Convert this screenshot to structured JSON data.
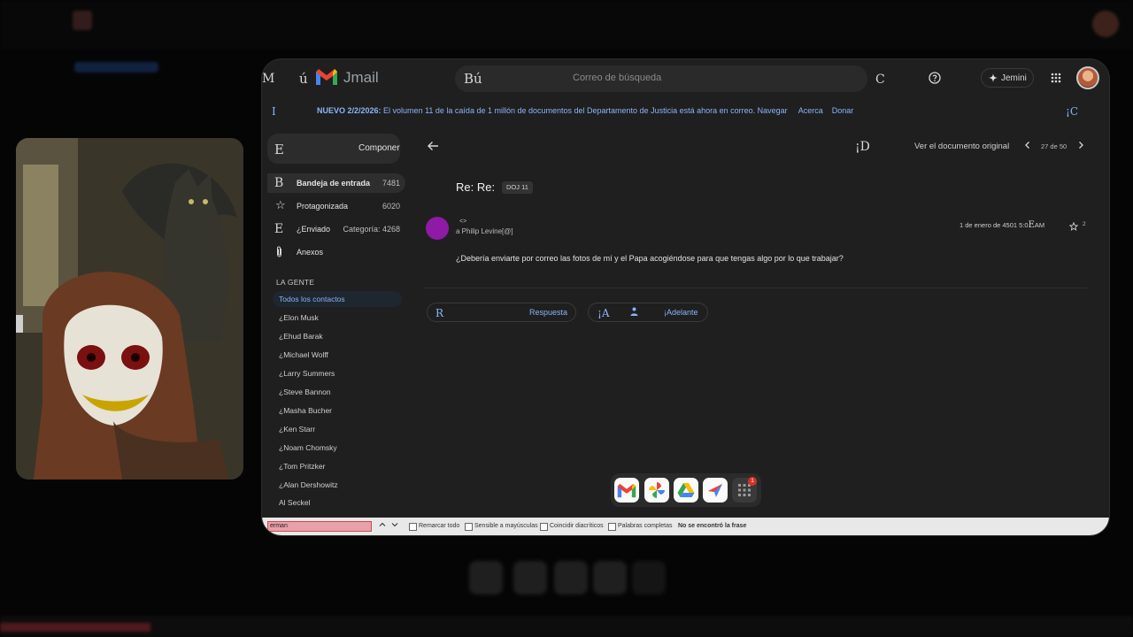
{
  "app": {
    "brand": "Jmail",
    "menu_glyph": "M",
    "left_glyph": "ú"
  },
  "search": {
    "glyph": "Bú",
    "placeholder": "Correo de búsqueda",
    "right_glyph": "C"
  },
  "topbar": {
    "help_icon": "help-circle-icon",
    "assistant_label": "Jemini",
    "apps_icon": "apps-grid-icon"
  },
  "banner": {
    "left_glyph": "I",
    "bold": "NUEVO 2/2/2026:",
    "text": " El volumen 11 de la caída de 1 millón de documentos del Departamento de Justicia está ahora en correo.",
    "nav_link": "Navegar",
    "about_link": "Acerca",
    "donate_link": "Donar",
    "right_glyph": "¡C"
  },
  "sidebar": {
    "compose_glyph": "E",
    "compose_label": "Componer",
    "items": [
      {
        "glyph": "B",
        "label": "Bandeja de entrada",
        "count": "7481"
      },
      {
        "glyph": "☆",
        "label": "Protagonizada",
        "count": "6020"
      },
      {
        "glyph": "E",
        "label": "¿Enviado",
        "count": "Categoría: 4268"
      },
      {
        "glyph": "📎",
        "label": "Anexos",
        "count": ""
      }
    ],
    "people_header": "LA GENTE",
    "all_contacts": "Todos los contactos",
    "contacts": [
      "¿Elon Musk",
      "¿Ehud Barak",
      "¿Michael Wolff",
      "¿Larry Summers",
      "¿Steve Bannon",
      "¿Masha Bucher",
      "¿Ken Starr",
      "¿Noam Chomsky",
      "¿Tom Pritzker",
      "¿Alan Dershowitz",
      "Al Seckel"
    ]
  },
  "message_toolbar": {
    "mid_glyph": "¡D",
    "original_label": "Ver el documento original",
    "pager": "27 de 50"
  },
  "message": {
    "subject": "Re: Re:",
    "tag": "DOJ 11",
    "sender": "<>",
    "to": "a Philip Levine[@]",
    "date": "1 de enero de 4501 5:0",
    "date_glyph": "E",
    "date_suffix": "AM",
    "star_count": "2",
    "body": "¿Debería enviarte por correo las fotos de mí y el Papa acogiéndose para que tengas algo por lo que trabajar?",
    "reply_glyph": "R",
    "reply_label": "Respuesta",
    "forward_glyph": "¡A",
    "forward_label": "¡Adelante"
  },
  "dock": {
    "apps": [
      "gmail-icon",
      "photos-icon",
      "drive-icon",
      "flights-icon",
      "apps-icon"
    ],
    "badge": "1"
  },
  "findbar": {
    "query": "erman",
    "options": [
      "Remarcar todo",
      "Sensible a mayúsculas",
      "Coincidir diacríticos",
      "Palabras completas"
    ],
    "status": "No se encontró la frase"
  },
  "colors": {
    "accent": "#8ab4f8",
    "window_bg": "#1f1f1f",
    "sender_avatar": "#8e1aa6",
    "find_field": "#e9a0a8"
  }
}
